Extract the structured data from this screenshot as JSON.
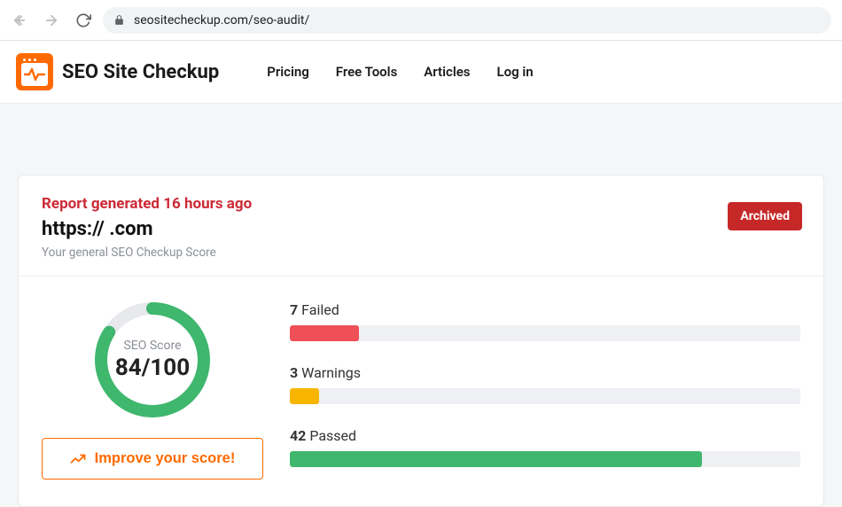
{
  "browser": {
    "url_display": "seositecheckup.com/seo-audit/"
  },
  "brand": {
    "name": "SEO Site Checkup"
  },
  "nav": {
    "pricing": "Pricing",
    "free_tools": "Free Tools",
    "articles": "Articles",
    "login": "Log in"
  },
  "report": {
    "generated": "Report generated 16 hours ago",
    "target_url": "https://                  .com",
    "subtitle": "Your general SEO Checkup Score",
    "archived_label": "Archived"
  },
  "score": {
    "label": "SEO Score",
    "display": "84/100",
    "value": 84,
    "max": 100
  },
  "improve_label": "Improve your score!",
  "metrics": {
    "failed": {
      "count": "7",
      "label": "Failed",
      "value": 7,
      "total": 52
    },
    "warnings": {
      "count": "3",
      "label": "Warnings",
      "value": 3,
      "total": 52
    },
    "passed": {
      "count": "42",
      "label": "Passed",
      "value": 42,
      "total": 52
    }
  },
  "colors": {
    "accent_orange": "#ff6a00",
    "fail_red": "#ef4f57",
    "warn_yellow": "#f7b500",
    "pass_green": "#3fb76d",
    "brand_red": "#cc2a36",
    "archived_bg": "#c62828"
  },
  "chart_data": {
    "type": "bar",
    "title": "SEO Checkup results",
    "categories": [
      "Failed",
      "Warnings",
      "Passed"
    ],
    "values": [
      7,
      3,
      42
    ],
    "ylim": [
      0,
      52
    ],
    "gauge": {
      "label": "SEO Score",
      "value": 84,
      "max": 100
    }
  }
}
